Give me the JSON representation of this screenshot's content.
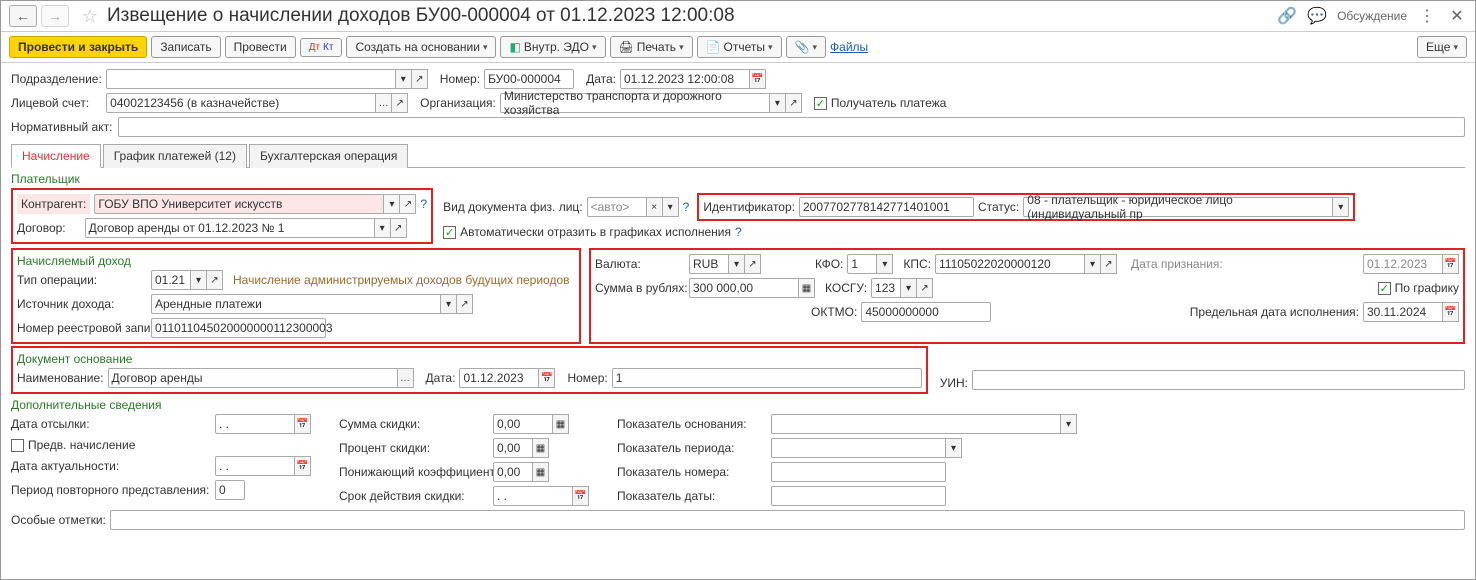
{
  "header": {
    "title": "Извещение о начислении доходов БУ00-000004 от 01.12.2023 12:00:08",
    "discussion": "Обсуждение"
  },
  "toolbar": {
    "post_close": "Провести и закрыть",
    "write": "Записать",
    "post": "Провести",
    "create_based": "Создать на основании",
    "edo": "Внутр. ЭДО",
    "print": "Печать",
    "reports": "Отчеты",
    "files": "Файлы",
    "more": "Еще"
  },
  "top": {
    "subdiv_label": "Подразделение:",
    "number_label": "Номер:",
    "number": "БУ00-000004",
    "date_label": "Дата:",
    "date": "01.12.2023 12:00:08",
    "account_label": "Лицевой счет:",
    "account": "04002123456 (в казначействе)",
    "org_label": "Организация:",
    "org": "Министерство транспорта и дорожного хозяйства",
    "recipient": "Получатель платежа",
    "norm_label": "Нормативный акт:"
  },
  "tabs": {
    "t1": "Начисление",
    "t2": "График платежей (12)",
    "t3": "Бухгалтерская операция"
  },
  "payer": {
    "section": "Плательщик",
    "contr_label": "Контрагент:",
    "contr": "ГОБУ ВПО Университет искусств",
    "doc_label": "Вид документа физ. лиц:",
    "doc_ph": "<авто>",
    "id_label": "Идентификатор:",
    "id": "2007702778142771401001",
    "status_label": "Статус:",
    "status": "08 - плательщик - юридическое лицо (индивидуальный пр",
    "contract_label": "Договор:",
    "contract": "Договор аренды от 01.12.2023 № 1",
    "auto": "Автоматически отразить в графиках исполнения"
  },
  "income": {
    "section": "Начисляемый доход",
    "optype_label": "Тип операции:",
    "optype": "01.21",
    "optype_hint": "Начисление администрируемых доходов будущих периодов",
    "source_label": "Источник дохода:",
    "source": "Арендные платежи",
    "reg_label": "Номер реестровой записи:",
    "reg": "011011045020000000112300003",
    "cur_label": "Валюта:",
    "cur": "RUB",
    "kfo_label": "КФО:",
    "kfo": "1",
    "kps_label": "КПС:",
    "kps": "11105022020000120",
    "recog_label": "Дата признания:",
    "recog": "01.12.2023",
    "sum_label": "Сумма в рублях:",
    "sum": "300 000,00",
    "kosgu_label": "КОСГУ:",
    "kosgu": "123",
    "sched": "По графику",
    "oktmo_label": "ОКТМО:",
    "oktmo": "45000000000",
    "limit_label": "Предельная дата исполнения:",
    "limit": "30.11.2024"
  },
  "basis": {
    "section": "Документ основание",
    "name_label": "Наименование:",
    "name": "Договор аренды",
    "date_label": "Дата:",
    "date": "01.12.2023",
    "num_label": "Номер:",
    "num": "1",
    "uin_label": "УИН:"
  },
  "extra": {
    "section": "Дополнительные сведения",
    "send_label": "Дата отсылки:",
    "send": "  .  .    ",
    "disc_sum_label": "Сумма скидки:",
    "disc_sum": "0,00",
    "ind_basis_label": "Показатель основания:",
    "preacc": "Предв. начисление",
    "disc_pct_label": "Процент скидки:",
    "disc_pct": "0,00",
    "ind_period_label": "Показатель периода:",
    "actual_label": "Дата актуальности:",
    "actual": "  .  .    ",
    "coef_label": "Понижающий коэффициент:",
    "coef": "0,00",
    "ind_num_label": "Показатель номера:",
    "repeat_label": "Период повторного представления:",
    "repeat": "0",
    "term_label": "Срок действия скидки:",
    "term": "  .  .    ",
    "ind_date_label": "Показатель даты:",
    "marks_label": "Особые отметки:"
  }
}
